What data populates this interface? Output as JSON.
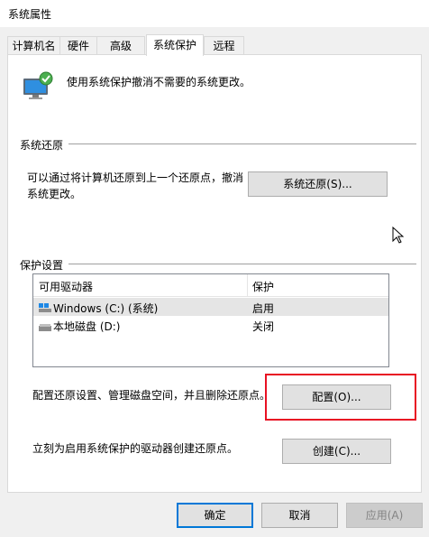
{
  "window": {
    "title": "系统属性"
  },
  "tabs": [
    {
      "label": "计算机名"
    },
    {
      "label": "硬件"
    },
    {
      "label": "高级"
    },
    {
      "label": "系统保护"
    },
    {
      "label": "远程"
    }
  ],
  "active_tab": "系统保护",
  "intro": {
    "text": "使用系统保护撤消不需要的系统更改。"
  },
  "restore_section": {
    "label": "系统还原",
    "desc_line1": "可以通过将计算机还原到上一个还原点，撤消",
    "desc_line2": "系统更改。",
    "button": "系统还原(S)..."
  },
  "protection_section": {
    "label": "保护设置",
    "columns": [
      "可用驱动器",
      "保护"
    ],
    "drives": [
      {
        "name": "Windows (C:) (系统)",
        "protection": "启用",
        "icon": "system-drive-icon"
      },
      {
        "name": "本地磁盘 (D:)",
        "protection": "关闭",
        "icon": "hard-disk-icon"
      }
    ],
    "configure_text": "配置还原设置、管理磁盘空间，并且删除还原点。",
    "configure_button": "配置(O)...",
    "create_text": "立刻为启用系统保护的驱动器创建还原点。",
    "create_button": "创建(C)..."
  },
  "footer": {
    "ok": "确定",
    "cancel": "取消",
    "apply": "应用(A)"
  },
  "colors": {
    "highlight": "#e81123",
    "accent": "#0078d7"
  }
}
